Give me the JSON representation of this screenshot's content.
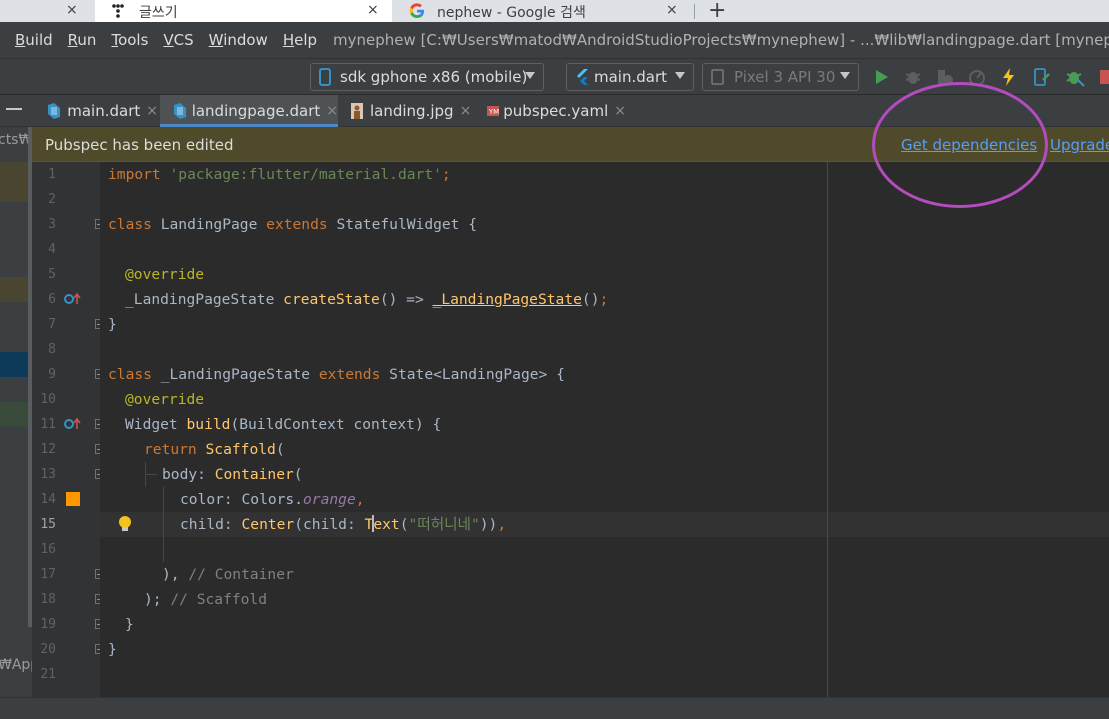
{
  "browser": {
    "tabs": [
      {
        "title": "",
        "close": "×"
      },
      {
        "title": "글쓰기",
        "close": "×"
      },
      {
        "title": "nephew - Google 검색",
        "close": "×"
      }
    ],
    "new_tab": "+"
  },
  "menu": {
    "items": [
      "Build",
      "Run",
      "Tools",
      "VCS",
      "Window",
      "Help"
    ],
    "mnemonic_rest": [
      "uild",
      "un",
      "ools",
      "CS",
      "indow",
      "elp"
    ],
    "mnemonic_first": [
      "B",
      "R",
      "T",
      "V",
      "W",
      "H"
    ],
    "project_title": "mynephew [C:₩Users₩matod₩AndroidStudioProjects₩mynephew] - ...₩lib₩landingpage.dart [mynephew]"
  },
  "toolbar": {
    "device": "sdk gphone x86 (mobile)",
    "run_config": "main.dart",
    "avd": "Pixel 3 API 30"
  },
  "editor_tabs": [
    {
      "label": "main.dart",
      "close": "×",
      "icon": "dart-file-icon"
    },
    {
      "label": "landingpage.dart",
      "close": "×",
      "icon": "dart-file-icon",
      "active": true
    },
    {
      "label": "landing.jpg",
      "close": "×",
      "icon": "image-file-icon"
    },
    {
      "label": "pubspec.yaml",
      "close": "×",
      "icon": "yaml-file-icon"
    }
  ],
  "notification": {
    "message": "Pubspec has been edited",
    "get_dependencies": "Get dependencies",
    "upgrade": "Upgrade"
  },
  "left_panel": {
    "top_text": "cts₩",
    "bottom_text": "₩App"
  },
  "line_numbers": [
    "1",
    "2",
    "3",
    "4",
    "5",
    "6",
    "7",
    "8",
    "9",
    "10",
    "11",
    "12",
    "13",
    "14",
    "15",
    "16",
    "17",
    "18",
    "19",
    "20",
    "21"
  ],
  "current_line": 15,
  "code": {
    "l1": {
      "a": "import ",
      "b": "'package:flutter/material.dart'",
      "c": ";"
    },
    "l3": {
      "a": "class ",
      "b": "LandingPage ",
      "c": "extends ",
      "d": "StatefulWidget {"
    },
    "l5": {
      "a": "@override"
    },
    "l6": {
      "a": "_LandingPageState ",
      "b": "createState",
      "c": "() => ",
      "d": "_LandingPageState",
      "e": "()",
      "f": ";"
    },
    "l7": {
      "a": "}"
    },
    "l9": {
      "a": "class ",
      "b": "_LandingPageState ",
      "c": "extends ",
      "d": "State<LandingPage> {"
    },
    "l10": {
      "a": "@override"
    },
    "l11": {
      "a": "Widget ",
      "b": "build",
      "c": "(BuildContext context) {"
    },
    "l12": {
      "a": "return ",
      "b": "Scaffold",
      "c": "("
    },
    "l13": {
      "a": "body: ",
      "b": "Container",
      "c": "("
    },
    "l14": {
      "a": "color: Colors.",
      "b": "orange",
      "c": ","
    },
    "l15": {
      "a": "child: ",
      "b": "Center",
      "c": "(child: ",
      "d": "T",
      "e": "ext",
      "f": "(",
      "g": "\"떠허니네\"",
      "h": "))",
      "i": ","
    },
    "l17": {
      "a": "), ",
      "b": "// Container"
    },
    "l18": {
      "a": "); ",
      "b": "// Scaffold"
    },
    "l19": {
      "a": "}"
    },
    "l20": {
      "a": "}"
    }
  },
  "colors": {
    "keyword": "#cc7832",
    "string": "#6a8759",
    "annotation": "#bbb529",
    "function": "#ffc66d",
    "comment": "#808080",
    "annotation_circle": "#b44bbf",
    "color_swatch": "#ff9800"
  }
}
